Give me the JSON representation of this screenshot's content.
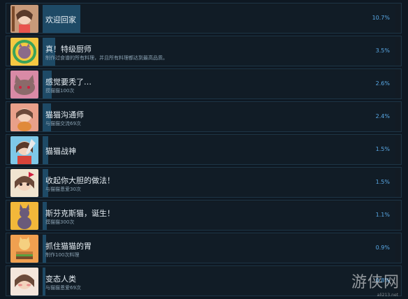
{
  "achievements": [
    {
      "title": "欢迎回家",
      "desc": "",
      "percent": "10.7%",
      "progress": 0.107,
      "icon": "girl-avatar-icon"
    },
    {
      "title": "真！特级厨师",
      "desc": "制作过食谱的所有料理，并且所有料理都达到最高品质。",
      "percent": "3.5%",
      "progress": 0.035,
      "icon": "cat-wreath-icon"
    },
    {
      "title": "感觉要秃了…",
      "desc": "摸猫猫100次",
      "percent": "2.6%",
      "progress": 0.026,
      "icon": "cat-face-icon"
    },
    {
      "title": "猫猫沟通师",
      "desc": "与猫猫交流69次",
      "percent": "2.4%",
      "progress": 0.024,
      "icon": "girl-cat-icon"
    },
    {
      "title": "猫猫战神",
      "desc": "",
      "percent": "1.5%",
      "progress": 0.015,
      "icon": "warrior-girl-icon"
    },
    {
      "title": "收起你大胆的做法！",
      "desc": "与猫猫恩爱30次",
      "percent": "1.5%",
      "progress": 0.015,
      "icon": "girl-bow-icon"
    },
    {
      "title": "斯芬克斯猫，诞生！",
      "desc": "摸猫猫300次",
      "percent": "1.1%",
      "progress": 0.011,
      "icon": "sphinx-cat-icon"
    },
    {
      "title": "抓住猫猫的胃",
      "desc": "制作100次料理",
      "percent": "0.9%",
      "progress": 0.009,
      "icon": "cat-burger-icon"
    },
    {
      "title": "变态人类",
      "desc": "与猫猫恩爱69次",
      "percent": "0.8%",
      "progress": 0.008,
      "icon": "girl-blush-icon"
    }
  ],
  "watermark": {
    "text": "游侠网",
    "url": "ali213.net"
  },
  "colors": {
    "accent": "#5aa9e6",
    "bar": "#1e4a66",
    "background": "#0e1822"
  }
}
